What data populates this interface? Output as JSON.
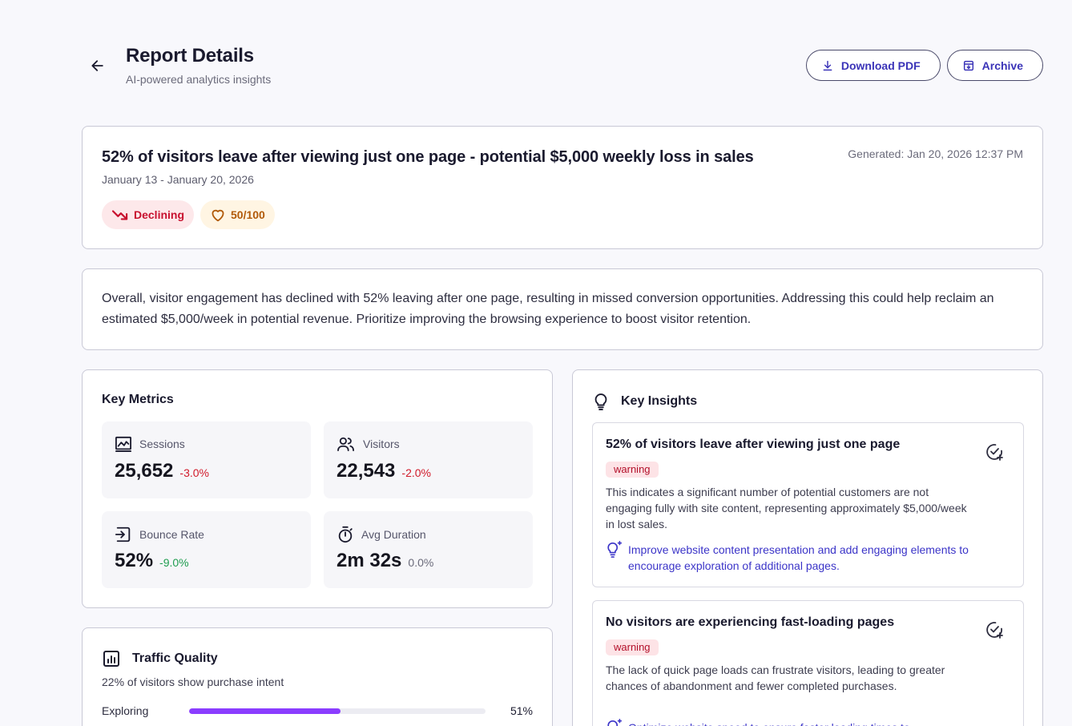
{
  "header": {
    "title": "Report Details",
    "subtitle": "AI-powered analytics insights",
    "download_label": "Download PDF",
    "archive_label": "Archive"
  },
  "report": {
    "headline": "52% of visitors leave after viewing just one page - potential $5,000 weekly loss in sales",
    "date_range": "January 13 - January 20, 2026",
    "generated": "Generated: Jan 20, 2026 12:37 PM",
    "trend_label": "Declining",
    "score_label": "50/100"
  },
  "summary": {
    "text": "Overall, visitor engagement has declined with 52% leaving after one page, resulting in missed conversion opportunities. Addressing this could help reclaim an estimated $5,000/week in potential revenue. Prioritize improving the browsing experience to boost visitor retention."
  },
  "metrics": {
    "title": "Key Metrics",
    "items": [
      {
        "label": "Sessions",
        "value": "25,652",
        "change": "-3.0%",
        "icon": "sessions-chart-icon"
      },
      {
        "label": "Visitors",
        "value": "22,543",
        "change": "-2.0%",
        "icon": "users-icon"
      },
      {
        "label": "Bounce Rate",
        "value": "52%",
        "change": "-9.0%",
        "icon": "exit-icon"
      },
      {
        "label": "Avg Duration",
        "value": "2m 32s",
        "change": "0.0%",
        "icon": "stopwatch-icon"
      }
    ]
  },
  "traffic": {
    "title": "Traffic Quality",
    "subtitle": "22% of visitors show purchase intent",
    "rows": [
      {
        "label": "Exploring",
        "percent_label": "51%",
        "percent": 51
      }
    ]
  },
  "insights": {
    "title": "Key Insights",
    "items": [
      {
        "title": "52% of visitors leave after viewing just one page",
        "tag": "warning",
        "body": "This indicates a significant number of potential customers are not engaging fully with site content, representing approximately $5,000/week in lost sales.",
        "action": "Improve website content presentation and add engaging elements to encourage exploration of additional pages."
      },
      {
        "title": "No visitors are experiencing fast-loading pages",
        "tag": "warning",
        "body": "The lack of quick page loads can frustrate visitors, leading to greater chances of abandonment and fewer completed purchases.",
        "action": "Optimize website speed to ensure faster loading times to"
      }
    ]
  },
  "colors": {
    "accent": "#3b34b8",
    "declining": "#c8102e",
    "score": "#b15a09",
    "bar_fill": "#8b3dff",
    "positive": "#1f9d50",
    "negative": "#d11a2a"
  }
}
